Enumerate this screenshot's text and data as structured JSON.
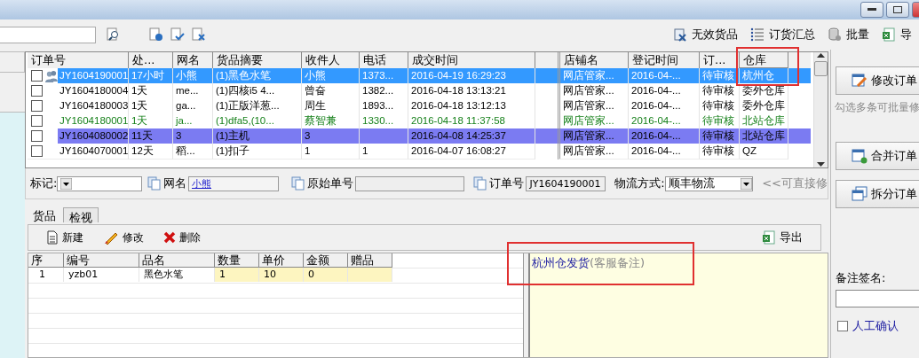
{
  "toolbar": {
    "buttons": [
      {
        "kind": "invalid",
        "label": "无效货品"
      },
      {
        "kind": "summary",
        "label": "订货汇总"
      },
      {
        "kind": "batch",
        "label": "批量"
      },
      {
        "kind": "export",
        "label": "导"
      }
    ]
  },
  "orders": {
    "columns": [
      {
        "label": "订单号",
        "highlighted": false
      },
      {
        "label": "处...",
        "highlighted": false
      },
      {
        "label": "网名",
        "highlighted": false
      },
      {
        "label": "货品摘要",
        "highlighted": false
      },
      {
        "label": "收件人",
        "highlighted": false
      },
      {
        "label": "电话",
        "highlighted": false
      },
      {
        "label": "成交时间",
        "highlighted": false
      },
      {
        "label": "店铺名",
        "highlighted": false
      },
      {
        "label": "登记时间",
        "highlighted": false
      },
      {
        "label": "订...",
        "highlighted": false
      },
      {
        "label": "仓库",
        "highlighted": true
      }
    ],
    "rows": [
      {
        "checked": false,
        "selected": true,
        "kind": "plain",
        "has_icon": true,
        "cells": [
          "JY1604190001",
          "17小时",
          "小熊",
          "(1)黑色水笔",
          "小熊",
          "1373...",
          "2016-04-19 16:29:23",
          "网店管家...",
          "2016-04-...",
          "待审核",
          "杭州仓"
        ]
      },
      {
        "checked": false,
        "selected": false,
        "kind": "plain",
        "has_icon": false,
        "cells": [
          "JY1604180004",
          "1天",
          "me...",
          "(1)四核i5 4...",
          "曾奋",
          "1382...",
          "2016-04-18 13:13:21",
          "网店管家...",
          "2016-04-...",
          "待审核",
          "委外仓库"
        ]
      },
      {
        "checked": false,
        "selected": false,
        "kind": "plain",
        "has_icon": false,
        "cells": [
          "JY1604180003",
          "1天",
          "ga...",
          "(1)正版洋葱...",
          "周生",
          "1893...",
          "2016-04-18 13:12:13",
          "网店管家...",
          "2016-04-...",
          "待审核",
          "委外仓库"
        ]
      },
      {
        "checked": false,
        "selected": false,
        "kind": "green",
        "has_icon": false,
        "cells": [
          "JY1604180001",
          "1天",
          "ja...",
          "(1)dfa5,(10...",
          "蔡智兼",
          "1330...",
          "2016-04-18 11:37:58",
          "网店管家...",
          "2016-04-...",
          "待审核",
          "北站仓库"
        ]
      },
      {
        "checked": false,
        "selected": false,
        "kind": "flagged",
        "has_icon": false,
        "cells": [
          "JY1604080002",
          "11天",
          "3",
          "(1)主机",
          "3",
          null,
          "2016-04-08 14:25:37",
          "网店管家...",
          "2016-04-...",
          "待审核",
          "北站仓库"
        ]
      },
      {
        "checked": false,
        "selected": false,
        "kind": "plain",
        "has_icon": false,
        "cells": [
          "JY1604070001",
          "12天",
          "稻...",
          "(1)扣子",
          "1",
          "1",
          "2016-04-07 16:08:27",
          "网店管家...",
          "2016-04-...",
          "待审核",
          "QZ"
        ]
      }
    ]
  },
  "fields": {
    "mark_label": "标记:",
    "buyer_label": "网名",
    "buyer_value": "小熊",
    "source_label": "原始单号",
    "order_label": "订单号",
    "order_value": "JY1604190001",
    "shipping_label": "物流方式:",
    "shipping_value": "顺丰物流",
    "hint": "<<可直接修"
  },
  "tabs": [
    {
      "label": "货品",
      "selected": true
    },
    {
      "label": "检视",
      "selected": false
    }
  ],
  "detail_toolbar": {
    "buttons": [
      {
        "kind": "new",
        "label": "新建"
      },
      {
        "kind": "edit",
        "label": "修改"
      },
      {
        "kind": "delete",
        "label": "删除"
      }
    ],
    "export": "导出"
  },
  "items": {
    "columns": [
      {
        "label": "序",
        "editable": false
      },
      {
        "label": "编号",
        "editable": false
      },
      {
        "label": "品名",
        "editable": false
      },
      {
        "label": "数量",
        "editable": true
      },
      {
        "label": "单价",
        "editable": true
      },
      {
        "label": "金额",
        "editable": true
      },
      {
        "label": "赠品",
        "editable": true
      }
    ],
    "rows": [
      {
        "cells": [
          "1",
          "yzb01",
          "黑色水笔",
          "1",
          "10",
          "0",
          null
        ]
      }
    ]
  },
  "note": {
    "text": "杭州仓发货",
    "hint": "(客服备注)",
    "highlighted": true
  },
  "side": {
    "buttons": [
      {
        "kind": "edit",
        "label": "修改订单"
      },
      {
        "kind": "merge",
        "label": "合并订单"
      },
      {
        "kind": "split",
        "label": "拆分订单"
      }
    ],
    "batch_hint": "勾选多条可批量修",
    "signature_label": "备注签名:",
    "confirm": {
      "label": "人工确认",
      "checked": false
    }
  }
}
